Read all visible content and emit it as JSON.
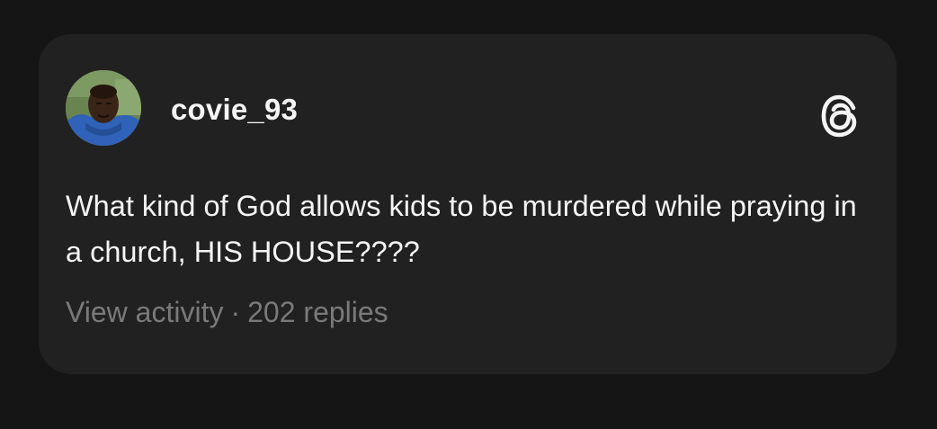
{
  "post": {
    "username": "covie_93",
    "text": "What kind of God allows kids to be murdered while praying in a church, HIS HOUSE????",
    "view_activity_label": "View activity",
    "separator": "·",
    "replies_label": "202 replies"
  },
  "icons": {
    "brand": "threads-logo-icon",
    "avatar": "user-avatar"
  },
  "colors": {
    "background": "#151515",
    "card": "#212121",
    "text_primary": "#f5f5f5",
    "text_secondary": "#7a7a7a"
  }
}
